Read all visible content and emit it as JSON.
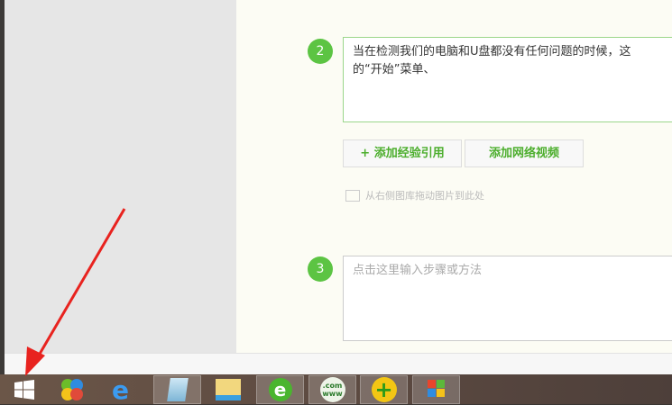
{
  "steps": [
    {
      "number": "2",
      "text": "当在检测我们的电脑和U盘都没有任何问题的时候，这",
      "text2": "的“开始”菜单、"
    },
    {
      "number": "3",
      "placeholder": "点击这里输入步骤或方法"
    }
  ],
  "buttons": {
    "add_reference": "+ 添加经验引用",
    "add_video": "添加网络视频"
  },
  "hint": "从右侧图库拖动图片到此处",
  "taskbar": [
    "start",
    "app-360",
    "internet-explorer",
    "notepad",
    "file-explorer",
    "browser-e",
    "dot-com",
    "add-tool",
    "windows-media"
  ],
  "colors": {
    "accent": "#5cc443"
  }
}
